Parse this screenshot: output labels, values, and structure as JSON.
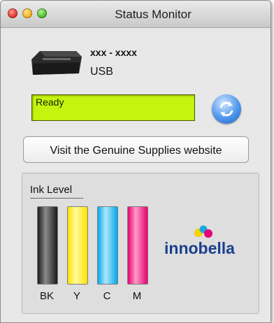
{
  "window": {
    "title": "Status Monitor"
  },
  "device": {
    "model": "xxx - xxxx",
    "connection": "USB"
  },
  "status": {
    "text": "Ready",
    "color": "#c5f50e"
  },
  "actions": {
    "visit_label": "Visit the Genuine Supplies website"
  },
  "ink": {
    "title": "Ink Level",
    "cartridges": [
      {
        "label": "BK",
        "color_dark": "#1a1a1a",
        "color_light": "#8a8a8a",
        "level": 1.0
      },
      {
        "label": "Y",
        "color_dark": "#ffe100",
        "color_light": "#fffa9e",
        "level": 1.0
      },
      {
        "label": "C",
        "color_dark": "#00a8e8",
        "color_light": "#aee7ff",
        "level": 1.0
      },
      {
        "label": "M",
        "color_dark": "#e7006f",
        "color_light": "#ff9cc8",
        "level": 1.0
      }
    ]
  },
  "brand": {
    "logo_text": "innobella"
  }
}
